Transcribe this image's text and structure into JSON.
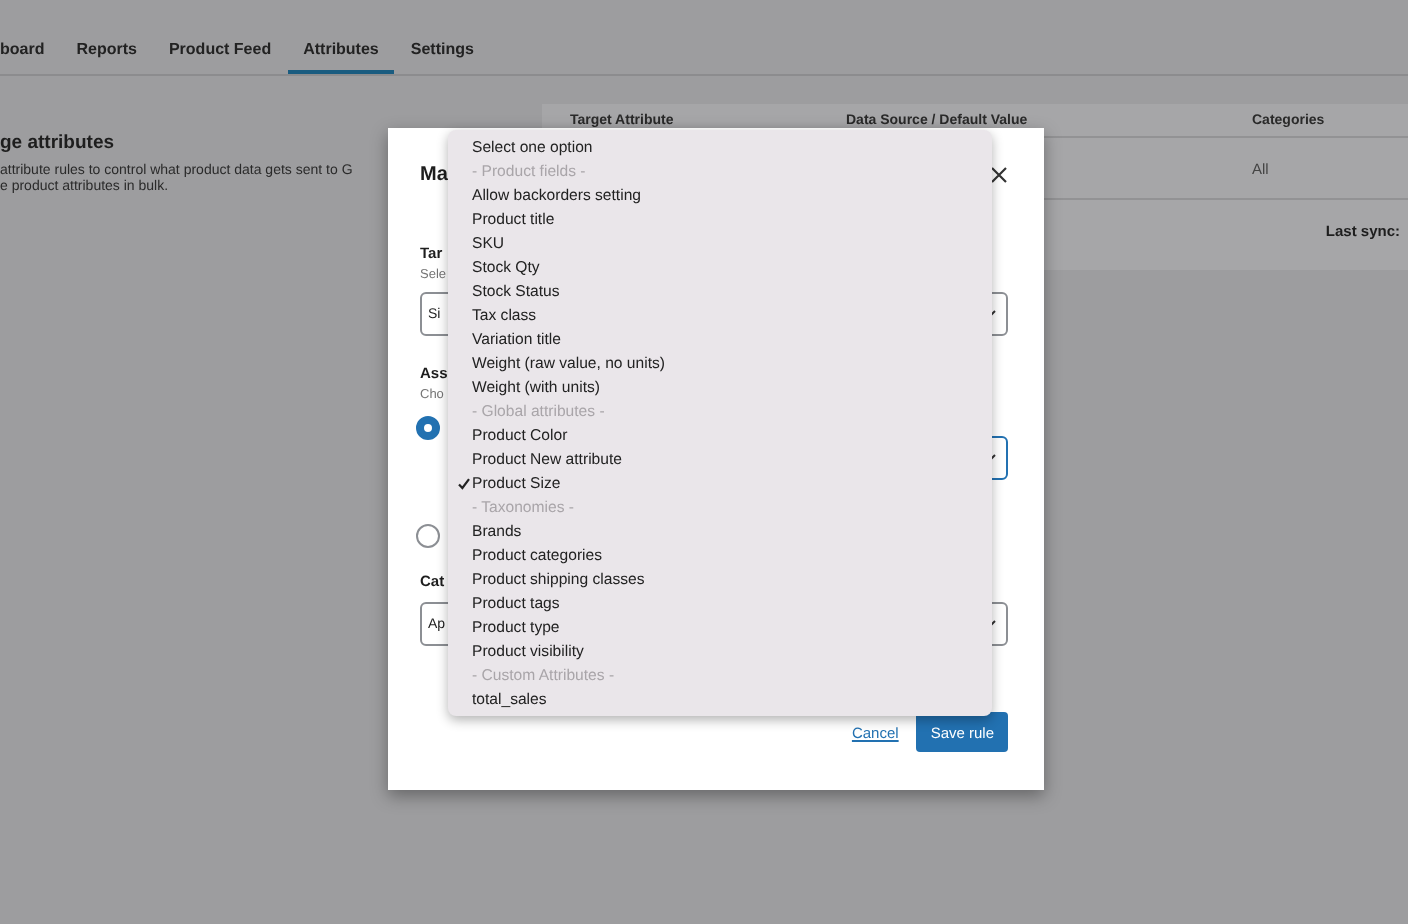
{
  "tabs": [
    {
      "label": "board",
      "selected": false
    },
    {
      "label": "Reports",
      "selected": false
    },
    {
      "label": "Product Feed",
      "selected": false
    },
    {
      "label": "Attributes",
      "selected": true
    },
    {
      "label": "Settings",
      "selected": false
    }
  ],
  "page": {
    "heading": "ge attributes",
    "description": [
      "attribute rules to control what product data gets sent to G",
      "e product attributes in bulk."
    ]
  },
  "table": {
    "columns": [
      "Target Attribute",
      "Data Source / Default Value",
      "Categories"
    ],
    "rows": [
      [
        "",
        "",
        "All"
      ]
    ],
    "last_sync": "Last sync:"
  },
  "modal": {
    "title": "Ma",
    "target_label": "Tar",
    "target_help": "Sele",
    "target_value": "Si",
    "assign_label": "Ass",
    "assign_help": "Cho",
    "radios": [
      {
        "selected": true
      },
      {
        "selected": false
      }
    ],
    "category_label": "Cat",
    "category_value": "Ap",
    "cancel": "Cancel",
    "save": "Save rule"
  },
  "dropdown": [
    {
      "kind": "option",
      "label": "Select one option",
      "selected": false
    },
    {
      "kind": "group",
      "label": "- Product fields -"
    },
    {
      "kind": "option",
      "label": "Allow backorders setting",
      "selected": false
    },
    {
      "kind": "option",
      "label": "Product title",
      "selected": false
    },
    {
      "kind": "option",
      "label": "SKU",
      "selected": false
    },
    {
      "kind": "option",
      "label": "Stock Qty",
      "selected": false
    },
    {
      "kind": "option",
      "label": "Stock Status",
      "selected": false
    },
    {
      "kind": "option",
      "label": "Tax class",
      "selected": false
    },
    {
      "kind": "option",
      "label": "Variation title",
      "selected": false
    },
    {
      "kind": "option",
      "label": "Weight (raw value, no units)",
      "selected": false
    },
    {
      "kind": "option",
      "label": "Weight (with units)",
      "selected": false
    },
    {
      "kind": "group",
      "label": "- Global attributes -"
    },
    {
      "kind": "option",
      "label": "Product Color",
      "selected": false
    },
    {
      "kind": "option",
      "label": "Product New attribute",
      "selected": false
    },
    {
      "kind": "option",
      "label": "Product Size",
      "selected": true
    },
    {
      "kind": "group",
      "label": "- Taxonomies -"
    },
    {
      "kind": "option",
      "label": "Brands",
      "selected": false
    },
    {
      "kind": "option",
      "label": "Product categories",
      "selected": false
    },
    {
      "kind": "option",
      "label": "Product shipping classes",
      "selected": false
    },
    {
      "kind": "option",
      "label": "Product tags",
      "selected": false
    },
    {
      "kind": "option",
      "label": "Product type",
      "selected": false
    },
    {
      "kind": "option",
      "label": "Product visibility",
      "selected": false
    },
    {
      "kind": "group",
      "label": "- Custom Attributes -"
    },
    {
      "kind": "option",
      "label": "total_sales",
      "selected": false
    }
  ]
}
